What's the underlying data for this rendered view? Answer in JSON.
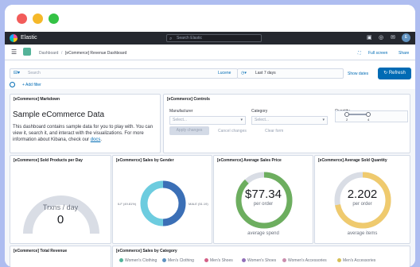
{
  "topnav": {
    "brand": "Elastic",
    "search_placeholder": "Search Elastic",
    "avatar": "E"
  },
  "breadcrumbs": {
    "first": "Dashboard",
    "second": "[eCommerce] Revenue Dashboard",
    "full_screen": "Full screen",
    "share": "Share"
  },
  "query": {
    "placeholder": "Search",
    "language": "Lucene",
    "date_range": "Last 7 days",
    "show_dates": "Show dates",
    "refresh": "Refresh",
    "add_filter": "+ Add filter"
  },
  "markdown_panel": {
    "title": "[eCommerce] Markdown",
    "heading": "Sample eCommerce Data",
    "body": "This dashboard contains sample data for you to play with. You can view it, search it, and interact with the visualizations. For more information about Kibana, check our ",
    "link": "docs",
    "end": "."
  },
  "controls_panel": {
    "title": "[eCommerce] Controls",
    "manufacturer_label": "Manufacturer",
    "manufacturer_placeholder": "Select...",
    "category_label": "Category",
    "category_placeholder": "Select...",
    "quantity_label": "Quantity",
    "range_min": "2",
    "range_max": "4",
    "apply": "Apply changes",
    "cancel": "Cancel changes",
    "clear": "Clear form"
  },
  "sold_per_day": {
    "title": "[eCommerce] Sold Products per Day",
    "label": "Trxns / day",
    "value": "0"
  },
  "sales_by_gender": {
    "title": "[eCommerce] Sales by Gender",
    "left_label": "ILF (49.81%)",
    "right_label": "MALE (51.19)"
  },
  "avg_sales_price": {
    "title": "[eCommerce] Average Sales Price",
    "value": "$77.34",
    "sub": "per order",
    "label": "average spend",
    "fraction": 0.88
  },
  "avg_sold_quantity": {
    "title": "[eCommerce] Average Sold Quantity",
    "value": "2.202",
    "sub": "per order",
    "label": "average items",
    "fraction": 0.72
  },
  "total_revenue": {
    "title": "[eCommerce] Total Revenue"
  },
  "sales_by_category": {
    "title": "[eCommerce] Sales by Category",
    "legend": [
      "Women's Clothing",
      "Men's Clothing",
      "Men's Shoes",
      "Women's Shoes",
      "Women's Accessories",
      "Men's Accessories"
    ]
  },
  "colors": {
    "gauge_green": "#6dae5f",
    "gauge_yellow": "#efca6e",
    "gauge_track": "#d9dde5",
    "donut_light": "#6dccdf",
    "donut_dark": "#3b6fb6",
    "legend": [
      "#54b399",
      "#6092c0",
      "#d36086",
      "#9170b8",
      "#ca8eae",
      "#d6bf57"
    ]
  }
}
